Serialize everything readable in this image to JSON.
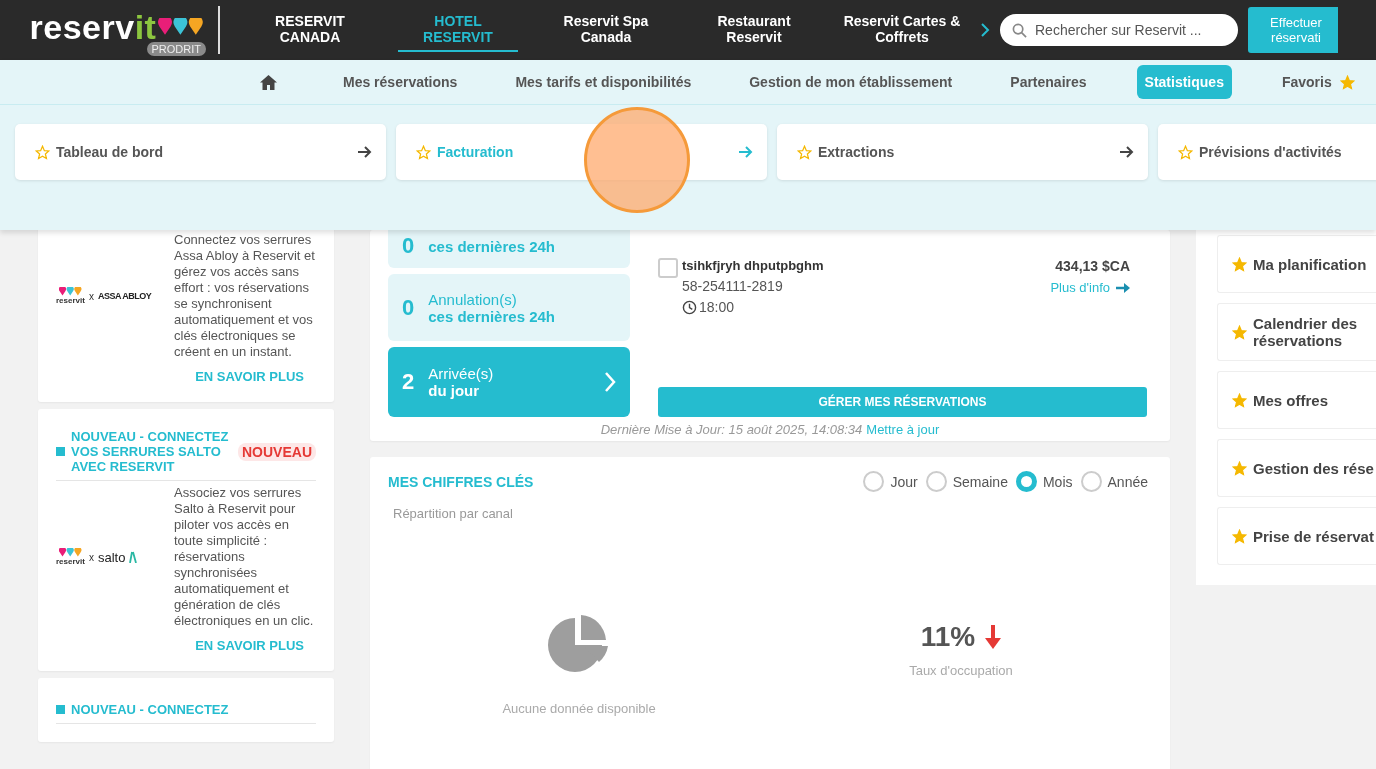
{
  "header": {
    "logo": {
      "name": "reserv",
      "name_accent": "it",
      "badge": "PRODRIT"
    },
    "tabs": [
      {
        "label": "RESERVIT\nCANADA",
        "selected": false
      },
      {
        "label": "HOTEL\nRESERVIT",
        "selected": true
      },
      {
        "label": "Reservit Spa\nCanada",
        "selected": false
      },
      {
        "label": "Restaurant\nReservit",
        "selected": false
      },
      {
        "label": "Reservit Cartes &\nCoffrets",
        "selected": false
      }
    ],
    "search": {
      "placeholder": "Rechercher sur Reservit ..."
    },
    "action_button": "Effectuer\nréservati"
  },
  "nav": {
    "items": [
      {
        "kind": "home",
        "selected": false
      },
      {
        "kind": "text",
        "label": "Mes réservations",
        "selected": false
      },
      {
        "kind": "text",
        "label": "Mes tarifs et disponibilités",
        "selected": false
      },
      {
        "kind": "text",
        "label": "Gestion de mon établissement",
        "selected": false
      },
      {
        "kind": "text",
        "label": "Partenaires",
        "selected": false
      },
      {
        "kind": "text",
        "label": "Statistiques",
        "selected": true
      },
      {
        "kind": "favorite",
        "label": "Favoris",
        "selected": false
      }
    ]
  },
  "submenu": [
    {
      "kind": "full",
      "label": "Tableau de bord",
      "selected": false
    },
    {
      "kind": "full",
      "label": "Facturation",
      "selected": true
    },
    {
      "kind": "full",
      "label": "Extractions",
      "selected": false
    },
    {
      "kind": "cut",
      "label": "Prévisions d'activités",
      "selected": false
    }
  ],
  "cursor_highlight": true,
  "partner_cards": [
    {
      "kind": "body",
      "logo_name": "reservit",
      "separator": "x",
      "partner": "ASSA ABLOY",
      "partner_mark": false,
      "description": "Connectez vos serrures Assa Abloy à Reservit et gérez vos accès sans effort : vos réservations se synchronisent automatiquement et vos clés électroniques se créent en un instant.",
      "link": "EN SAVOIR PLUS"
    },
    {
      "kind": "full",
      "title": "NOUVEAU - CONNECTEZ VOS SERRURES SALTO AVEC RESERVIT",
      "badge": "NOUVEAU",
      "logo_name": "reservit",
      "separator": "x",
      "partner": "salto",
      "partner_mark": true,
      "description": "Associez vos serrures Salto à Reservit pour piloter vos accès en toute simplicité : réservations synchronisées automatiquement et génération de clés électroniques en un clic.",
      "link": "EN SAVOIR PLUS"
    },
    {
      "kind": "title",
      "title": "NOUVEAU - CONNECTEZ"
    }
  ],
  "reservations": {
    "stats": [
      {
        "value": "0",
        "subtitle": "ces dernières 24h",
        "selected": false
      },
      {
        "value": "0",
        "label": "Annulation(s)",
        "subtitle": "ces dernières 24h",
        "selected": false
      },
      {
        "value": "2",
        "label": "Arrivée(s)",
        "subtitle": "du jour",
        "selected": true
      }
    ],
    "entry": {
      "checked": false,
      "name": "tsihkfjryh dhputpbghm",
      "amount": "434,13 $CA",
      "number": "58-254111-2819",
      "time": "18:00",
      "link": "Plus d'info"
    },
    "button": "GÉRER MES RÉSERVATIONS",
    "updated": "Dernière Mise à Jour: 15 août 2025, 14:08:34",
    "refresh": "Mettre à jour"
  },
  "key_figures": {
    "title": "MES CHIFFRES CLÉS",
    "periods": [
      {
        "label": "Jour",
        "selected": false
      },
      {
        "label": "Semaine",
        "selected": false
      },
      {
        "label": "Mois",
        "selected": true
      },
      {
        "label": "Année",
        "selected": false
      }
    ],
    "subtitle": "Répartition par canal",
    "empty": "Aucune donnée disponible",
    "rate": "11%",
    "trend_down": true,
    "rate_label": "Taux d'occupation"
  },
  "favorites": [
    {
      "label": "Ma planification"
    },
    {
      "label": "Calendrier des réservations"
    },
    {
      "label": "Mes offres"
    },
    {
      "label": "Gestion des rése"
    },
    {
      "label": "Prise de réservat"
    }
  ]
}
